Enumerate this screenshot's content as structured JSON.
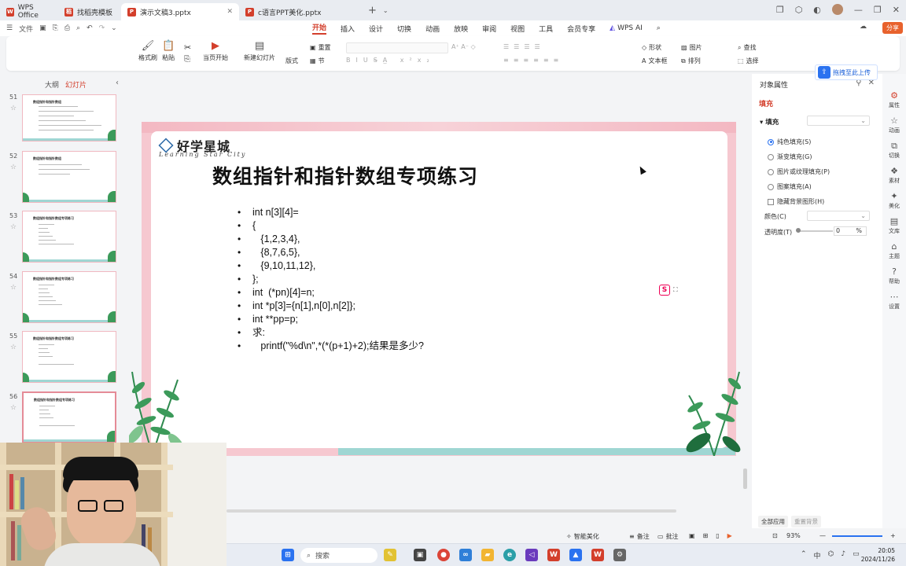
{
  "tabs": [
    {
      "label": "WPS Office",
      "color": "#d33f2c"
    },
    {
      "label": "找稻壳模板",
      "color": "#d33f2c"
    },
    {
      "label": "演示文稿3.pptx",
      "color": "#d33f2c"
    },
    {
      "label": "c语言PPT美化.pptx",
      "color": "#d33f2c"
    }
  ],
  "menu": {
    "file": "文件",
    "items": [
      "开始",
      "插入",
      "设计",
      "切换",
      "动画",
      "放映",
      "审阅",
      "视图",
      "工具",
      "会员专享"
    ],
    "active": "开始",
    "wps_ai": "WPS AI",
    "share": "分享"
  },
  "ribbon": {
    "format_painter": "格式刷",
    "paste": "粘贴",
    "start_from_current": "当页开始",
    "new_slide": "新建幻灯片",
    "layout": "版式",
    "reset": "重置",
    "section": "节",
    "shape": "形状",
    "picture": "图片",
    "textbox": "文本框",
    "arrange": "排列",
    "find": "查找",
    "select": "选择",
    "upload": "拖拽至此上传"
  },
  "left_panel": {
    "tab_outline": "大纲",
    "tab_slides": "幻灯片",
    "thumbnails": [
      {
        "num": "51",
        "title": "数组指针和指针数组"
      },
      {
        "num": "52",
        "title": "数组指针和指针数组"
      },
      {
        "num": "53",
        "title": "数组指针和指针数组专项练习"
      },
      {
        "num": "54",
        "title": "数组指针和指针数组专项练习"
      },
      {
        "num": "55",
        "title": "数组指针和指针数组专项练习"
      },
      {
        "num": "56",
        "title": "数组指针和指针数组专项练习"
      }
    ]
  },
  "slide": {
    "brand_cn": "好学星城",
    "brand_en": "Learning Star City",
    "title": "数组指针和指针数组专项练习",
    "lines": [
      "int n[3][4]=",
      "{",
      "   {1,2,3,4},",
      "   {8,7,6,5},",
      "   {9,10,11,12},",
      "};",
      "int  (*pn)[4]=n;",
      "int *p[3]={n[1],n[0],n[2]};",
      "int **pp=p;",
      "求:",
      "   printf(\"%d\\n\",*(*(p+1)+2);结果是多少?"
    ]
  },
  "right_panel": {
    "title": "对象属性",
    "tab": "填充",
    "section": "填充",
    "options": [
      "纯色填充(S)",
      "渐变填充(G)",
      "图片或纹理填充(P)",
      "图案填充(A)"
    ],
    "selected_option": 0,
    "hide_bg": "隐藏背景图形(H)",
    "color_label": "颜色(C)",
    "transparency_label": "透明度(T)",
    "transparency_value": "0",
    "transparency_unit": "%",
    "apply_all": "全部应用",
    "reset_bg": "重置背景"
  },
  "far_right": [
    "属性",
    "动画",
    "切换",
    "素材",
    "美化",
    "文库",
    "主题",
    "帮助",
    "设置"
  ],
  "statusbar": {
    "smart_beautify": "智能美化",
    "notes": "备注",
    "comments": "批注",
    "zoom": "93%"
  },
  "taskbar": {
    "search": "搜索",
    "time": "20:05",
    "date": "2024/11/26"
  }
}
